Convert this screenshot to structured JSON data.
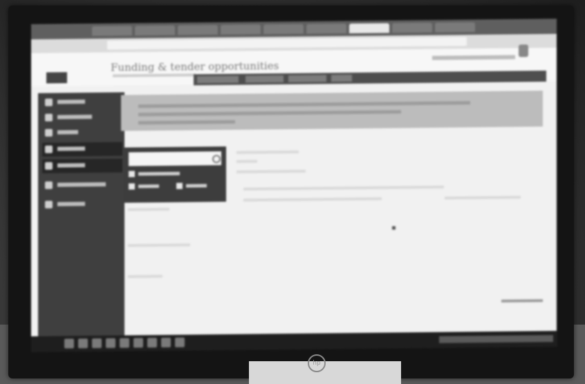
{
  "screen": {
    "header": {
      "title": "Funding & tender opportunities"
    }
  },
  "monitor": {
    "brand_logo": "hp"
  }
}
